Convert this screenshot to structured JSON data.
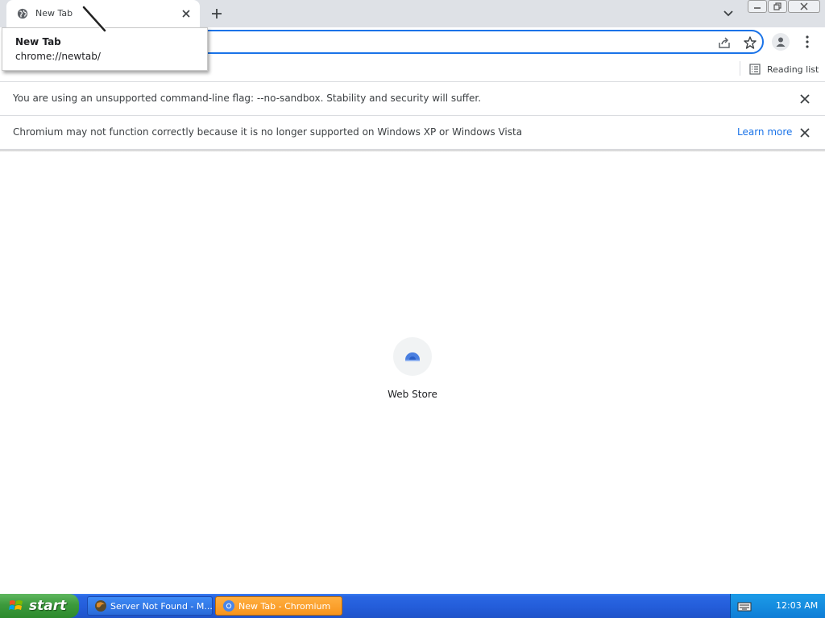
{
  "tabs": [
    {
      "title": "New Tab",
      "favicon": "globe-icon"
    }
  ],
  "tooltip": {
    "title": "New Tab",
    "url": "chrome://newtab/"
  },
  "toolbar": {
    "omnibox_value": ""
  },
  "bookmarks_bar": {
    "reading_list_label": "Reading list"
  },
  "infobars": [
    {
      "message": "You are using an unsupported command-line flag: --no-sandbox. Stability and security will suffer."
    },
    {
      "message": "Chromium may not function correctly because it is no longer supported on Windows XP or Windows Vista",
      "link": "Learn more"
    }
  ],
  "newtab": {
    "shortcut_label": "Web Store",
    "shortcut_icon": "web-store-icon"
  },
  "taskbar": {
    "start_label": "start",
    "tasks": [
      {
        "label": "Server Not Found - M..."
      },
      {
        "label": "New Tab - Chromium"
      }
    ],
    "clock": "12:03 AM"
  },
  "colors": {
    "accent": "#1a73e8",
    "taskbar": "#245edb",
    "start": "#3c9a3c",
    "active_task": "#f7941d"
  }
}
